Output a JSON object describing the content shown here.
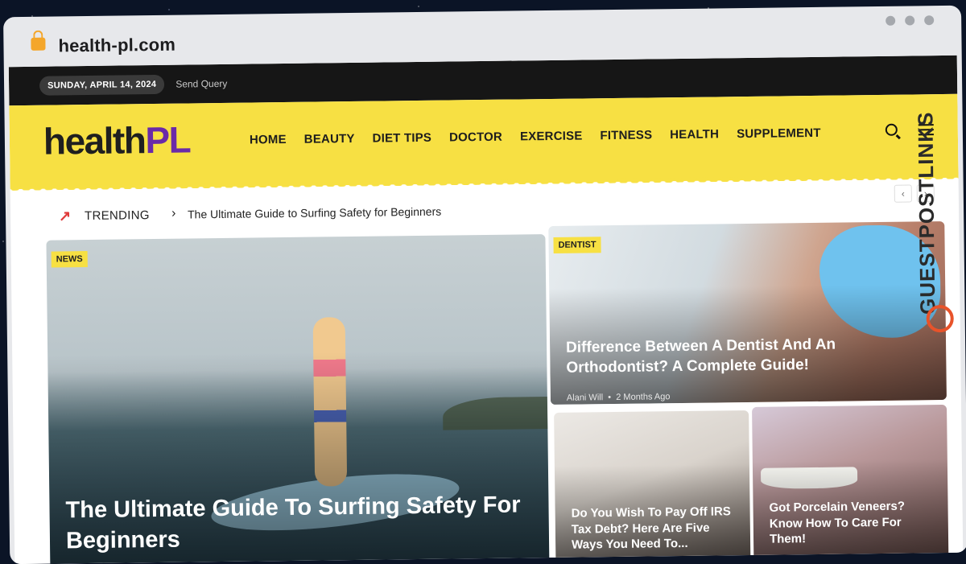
{
  "browser": {
    "url": "health-pl.com"
  },
  "topbar": {
    "date": "SUNDAY, APRIL 14, 2024",
    "send_query": "Send Query"
  },
  "logo": {
    "text_main": "health",
    "text_accent": "PL"
  },
  "nav": [
    "HOME",
    "BEAUTY",
    "DIET TIPS",
    "DOCTOR",
    "EXERCISE",
    "FITNESS",
    "HEALTH",
    "SUPPLEMENT"
  ],
  "trending": {
    "label": "TRENDING",
    "headline": "The Ultimate Guide to Surfing Safety for Beginners"
  },
  "cards": [
    {
      "tag": "NEWS",
      "title": "The Ultimate Guide To Surfing Safety For Beginners"
    },
    {
      "tag": "DENTIST",
      "title": "Difference Between A Dentist And An Orthodontist? A Complete Guide!",
      "author": "Alani Will",
      "date": "2 Months Ago"
    },
    {
      "title": "Do You Wish To Pay Off IRS Tax Debt? Here Are Five Ways You Need To..."
    },
    {
      "title": "Got Porcelain Veneers? Know How To Care For Them!"
    }
  ],
  "watermark": {
    "text": "GUESTPOSTLINKS"
  },
  "colors": {
    "header_yellow": "#f7e043",
    "topbar": "#161616",
    "logo_purple": "#6a2aa8"
  }
}
